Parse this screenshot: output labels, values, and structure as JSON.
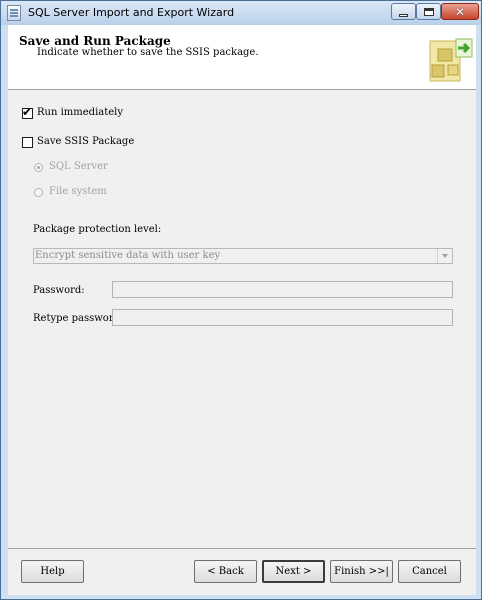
{
  "window": {
    "title": "SQL Server Import and Export Wizard"
  },
  "header": {
    "title": "Save and Run Package",
    "subtitle": "Indicate whether to save the SSIS package."
  },
  "options": {
    "run_immediately": {
      "label": "Run immediately",
      "checked": true
    },
    "save_ssis_package": {
      "label": "Save SSIS Package",
      "checked": false
    },
    "destinations": [
      {
        "label": "SQL Server",
        "selected": true,
        "enabled": false
      },
      {
        "label": "File system",
        "selected": false,
        "enabled": false
      }
    ]
  },
  "protection": {
    "label": "Package protection level:",
    "value": "Encrypt sensitive data with user key"
  },
  "password": {
    "label": "Password:",
    "value": ""
  },
  "retype_password": {
    "label": "Retype password:",
    "value": ""
  },
  "footer": {
    "help": "Help",
    "back": "< Back",
    "next": "Next >",
    "finish": "Finish >>|",
    "cancel": "Cancel"
  },
  "icons": {
    "app": "wizard-window-icon",
    "header_art": "wizard-package-icon"
  }
}
